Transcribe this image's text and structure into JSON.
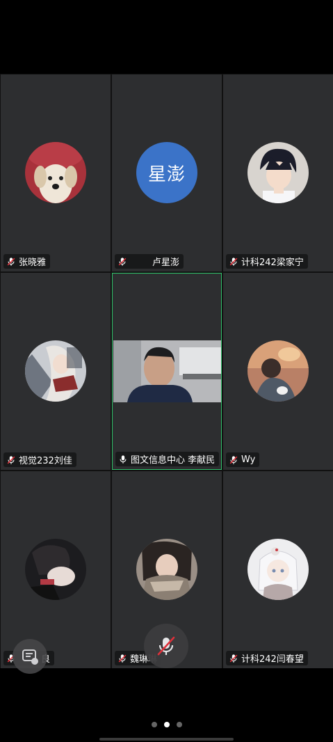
{
  "participants": [
    {
      "name": "张晓雅",
      "mic": "muted",
      "avatar": "photo-dog"
    },
    {
      "name": "卢星澎",
      "mic": "muted",
      "avatar_text": "星澎",
      "avatar_color": "#3b73c8"
    },
    {
      "name": "计科242梁家宁",
      "mic": "muted",
      "avatar": "photo-anime-boy"
    },
    {
      "name": "视觉232刘佳",
      "mic": "muted",
      "avatar": "photo-anime-character"
    },
    {
      "name": "图文信息中心 李献民",
      "mic": "on",
      "video": true,
      "active_speaker": true
    },
    {
      "name": "Wy",
      "mic": "muted",
      "avatar": "photo-sunset-figure"
    },
    {
      "name": "良",
      "mic": "muted",
      "avatar": "photo-dark-portrait"
    },
    {
      "name": "魏琳琳",
      "mic": "muted",
      "avatar": "photo-scarf-portrait"
    },
    {
      "name": "计科242闫春望",
      "mic": "muted",
      "avatar": "photo-anime-girl"
    }
  ],
  "controls": {
    "mute_button": "mic-muted-icon",
    "floating_button": "camera-switch-icon"
  },
  "pager": {
    "count": 3,
    "current": 2
  },
  "colors": {
    "tile_bg": "#2d2e30",
    "active_border": "#2fc36b",
    "mute_red": "#e0303a"
  }
}
